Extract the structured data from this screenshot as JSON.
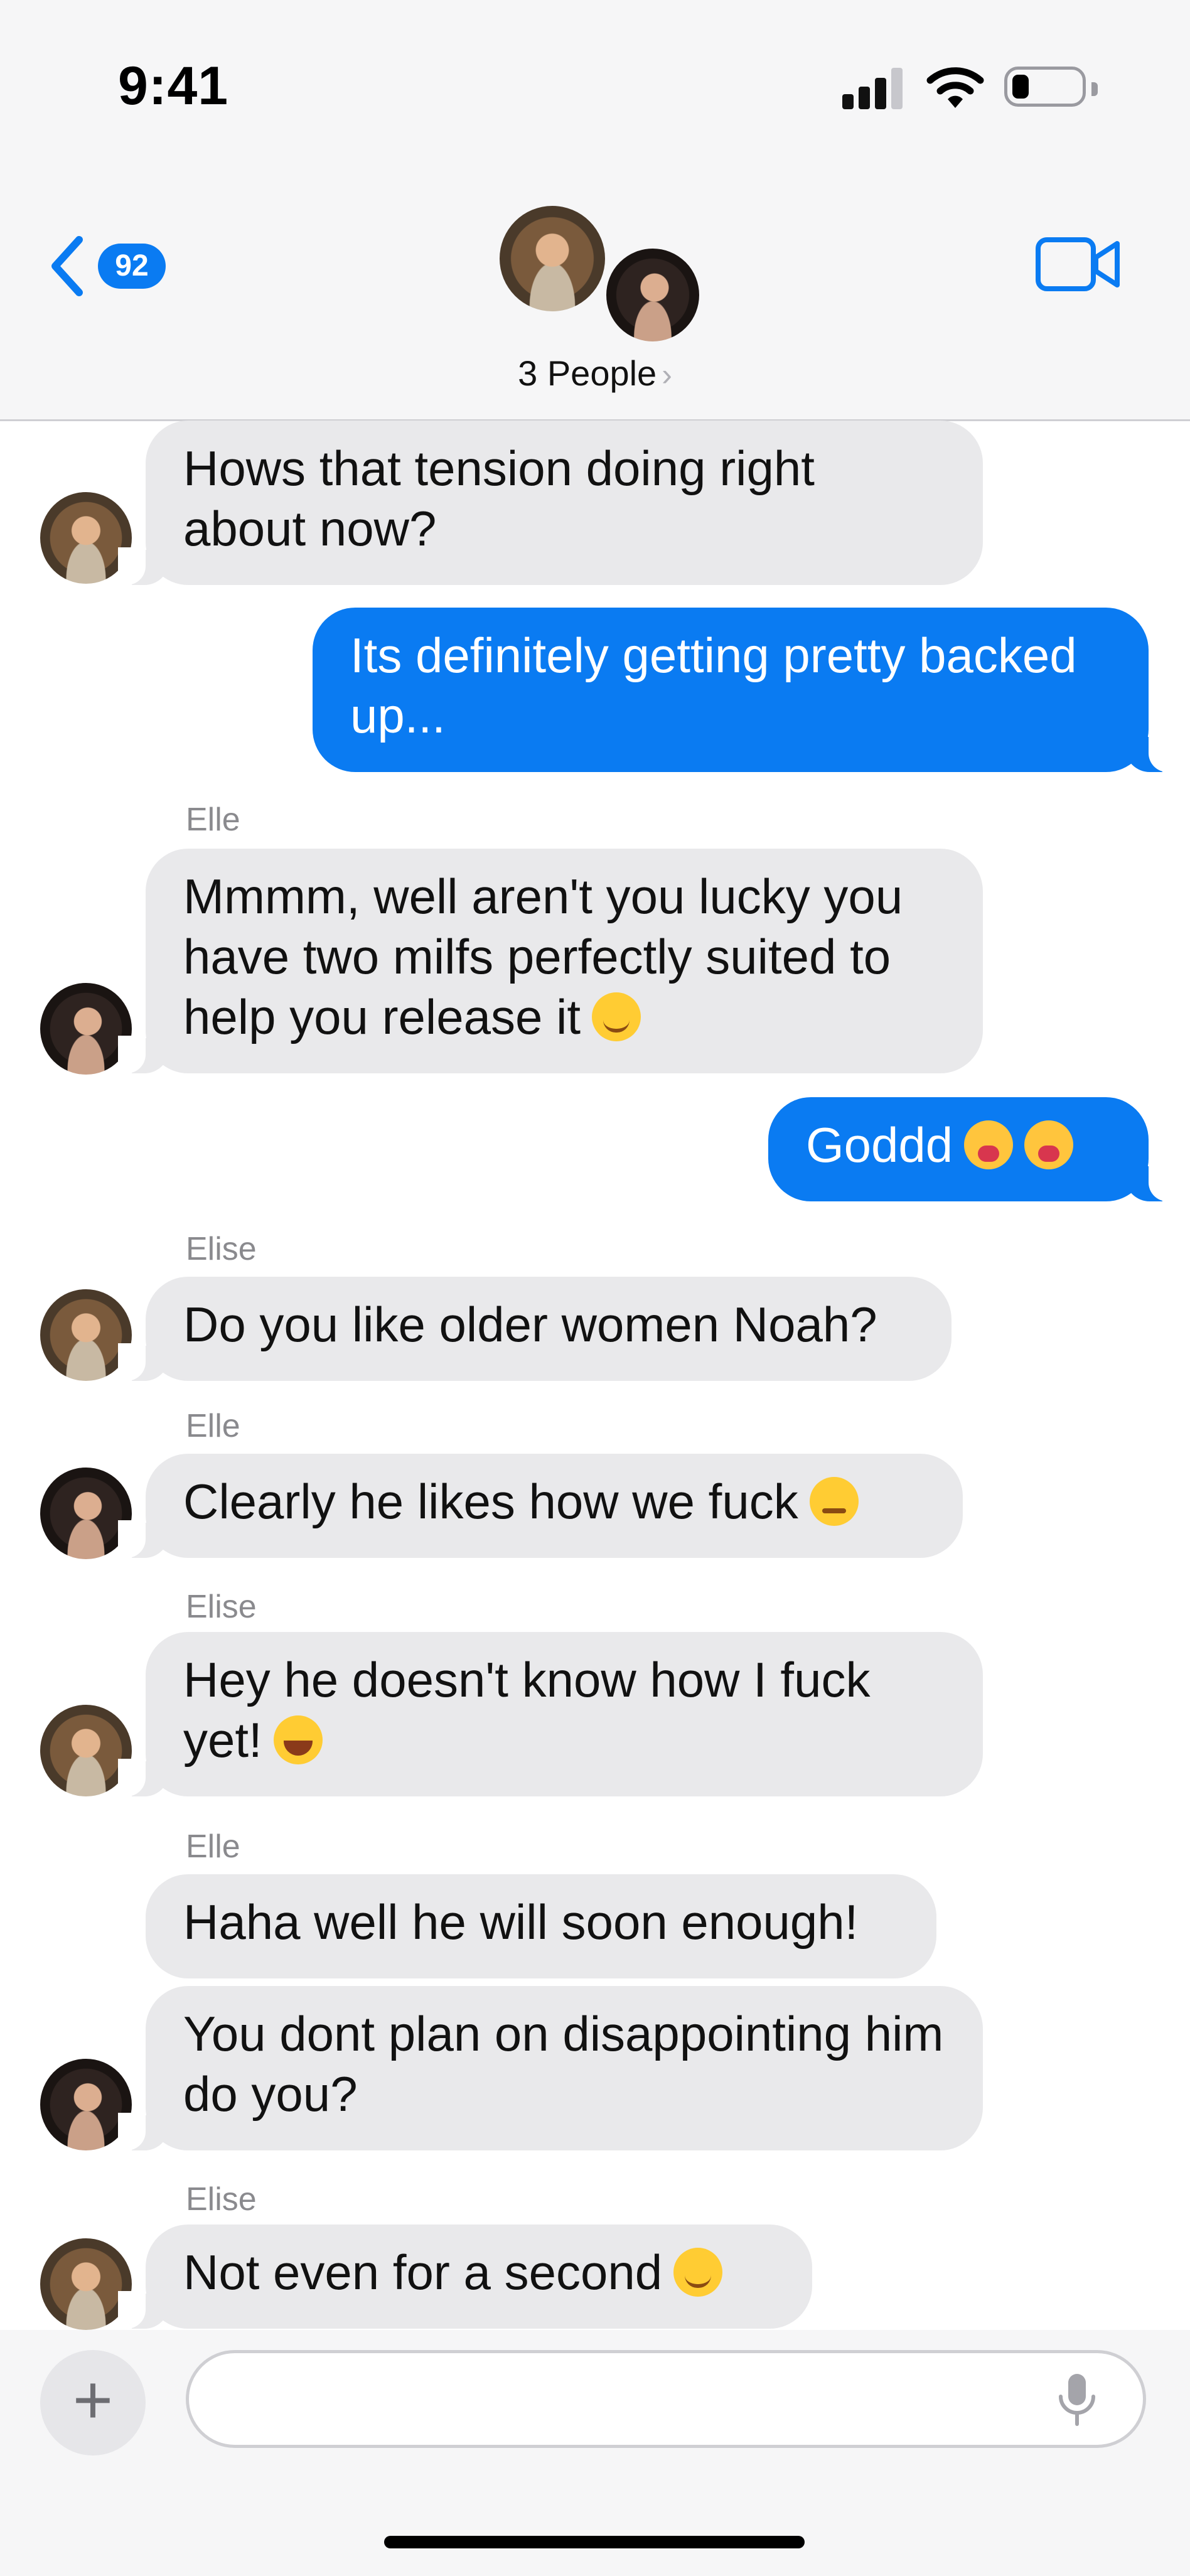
{
  "status_bar": {
    "time": "9:41"
  },
  "header": {
    "unread_count": "92",
    "title": "3 People",
    "title_chevron": "›"
  },
  "messages": [
    {
      "id": "m1",
      "direction": "incoming",
      "sender": "Elise",
      "show_sender": false,
      "text": "Hows that tension doing right about now?",
      "emoji": null
    },
    {
      "id": "m2",
      "direction": "outgoing",
      "text": "Its definitely getting pretty backed up...",
      "emoji": null
    },
    {
      "id": "m3",
      "direction": "incoming",
      "sender": "Elle",
      "show_sender": true,
      "text": "Mmmm, well aren't you lucky you have two milfs perfectly suited to help you release it",
      "emoji": "smirk"
    },
    {
      "id": "m4",
      "direction": "outgoing",
      "text": "Goddd",
      "emoji": "tired-face x2"
    },
    {
      "id": "m5",
      "direction": "incoming",
      "sender": "Elise",
      "show_sender": true,
      "text": "Do you like older women Noah?",
      "emoji": null
    },
    {
      "id": "m6",
      "direction": "incoming",
      "sender": "Elle",
      "show_sender": true,
      "text": "Clearly he likes how we fuck",
      "emoji": "rolling-eyes"
    },
    {
      "id": "m7",
      "direction": "incoming",
      "sender": "Elise",
      "show_sender": true,
      "text": "Hey he doesn't know how I fuck yet!",
      "emoji": "joy"
    },
    {
      "id": "m8",
      "direction": "incoming",
      "sender": "Elle",
      "show_sender": true,
      "text": "Haha well he will soon enough!",
      "emoji": null
    },
    {
      "id": "m9",
      "direction": "incoming",
      "sender": "Elle",
      "show_sender": false,
      "text": "You dont plan on disappointing him do you?",
      "emoji": null
    },
    {
      "id": "m10",
      "direction": "incoming",
      "sender": "Elise",
      "show_sender": true,
      "text": "Not even for a second",
      "emoji": "smirk"
    }
  ],
  "composer": {
    "placeholder": "",
    "plus_label": "+"
  },
  "icons": [
    "back-chevron-icon",
    "video-camera-icon",
    "plus-icon",
    "microphone-icon",
    "cellular-signal-icon",
    "wifi-icon",
    "battery-icon"
  ],
  "colors": {
    "outgoing_bubble": "#0a7bf2",
    "incoming_bubble": "#e9e9eb",
    "sender_label": "#8a8a8e",
    "badge": "#0a7bf2"
  }
}
